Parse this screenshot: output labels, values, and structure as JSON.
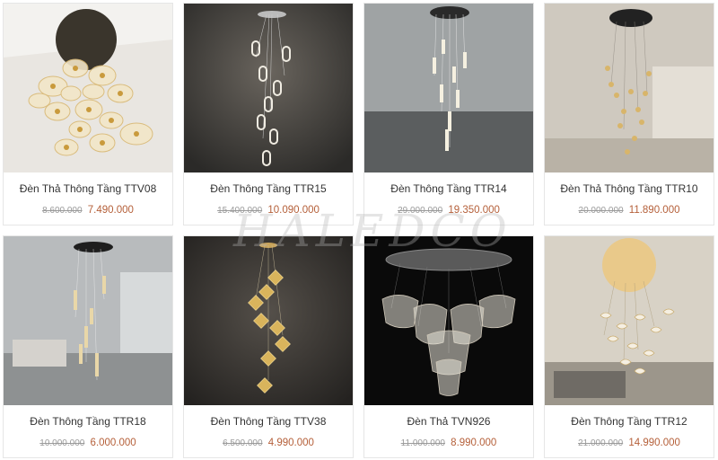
{
  "products": [
    {
      "name": "Đèn Thả Thông Tầng TTV08",
      "old_price": "8.600.000",
      "price": "7.490.000"
    },
    {
      "name": "Đèn Thông Tầng TTR15",
      "old_price": "15.400.000",
      "price": "10.090.000"
    },
    {
      "name": "Đèn Thông Tầng TTR14",
      "old_price": "29.000.000",
      "price": "19.350.000"
    },
    {
      "name": "Đèn Thả Thông Tầng TTR10",
      "old_price": "20.000.000",
      "price": "11.890.000"
    },
    {
      "name": "Đèn Thông Tầng TTR18",
      "old_price": "10.000.000",
      "price": "6.000.000"
    },
    {
      "name": "Đèn Thông Tầng TTV38",
      "old_price": "6.500.000",
      "price": "4.990.000"
    },
    {
      "name": "Đèn Thả TVN926",
      "old_price": "11.000.000",
      "price": "8.990.000"
    },
    {
      "name": "Đèn Thông Tầng TTR12",
      "old_price": "21.000.000",
      "price": "14.990.000"
    }
  ],
  "watermark": "HALEDCO"
}
